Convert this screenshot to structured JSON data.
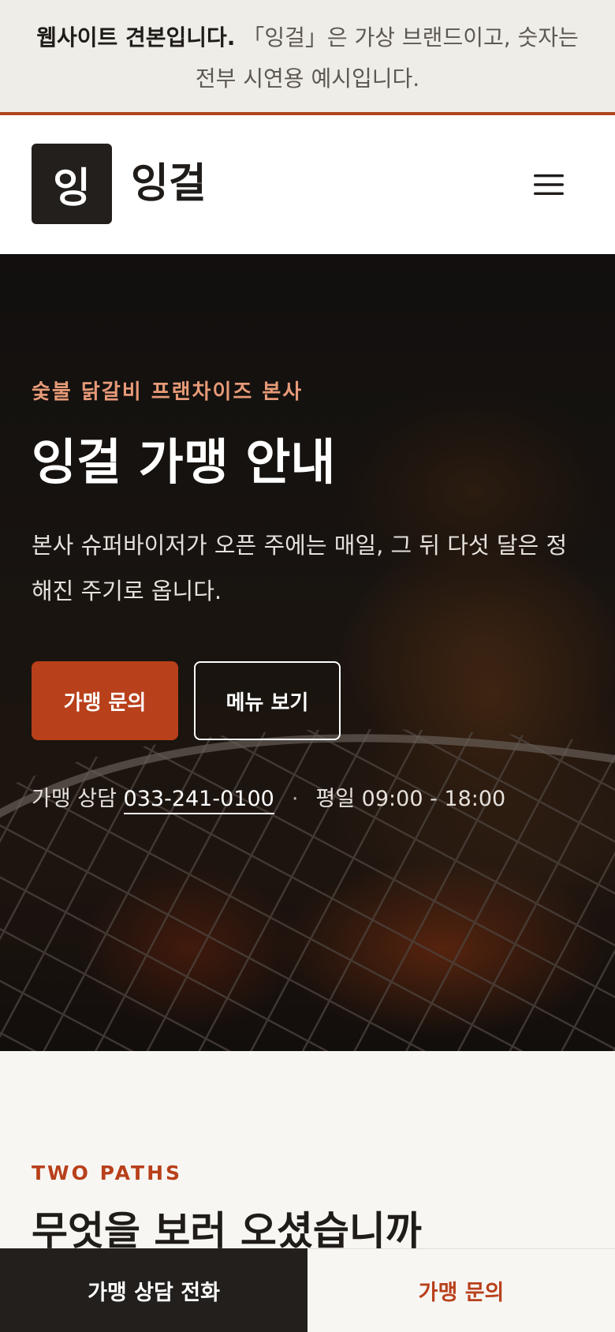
{
  "notice": {
    "bold": "웹사이트 견본입니다.",
    "text": " 「잉걸」은 가상 브랜드이고, 숫자는 전부 시연용 예시입니다."
  },
  "header": {
    "logo_mark": "잉",
    "brand_name": "잉걸",
    "menu_icon": "hamburger-menu-icon"
  },
  "hero": {
    "eyebrow": "숯불 닭갈비 프랜차이즈 본사",
    "title": "잉걸 가맹 안내",
    "description": "본사 슈퍼바이저가 오픈 주에는 매일, 그 뒤 다섯 달은 정해진 주기로 옵니다.",
    "primary_button": "가맹 문의",
    "secondary_button": "메뉴 보기",
    "contact_label": "가맹 상담",
    "phone": "033-241-0100",
    "separator": "·",
    "hours": "평일 09:00 - 18:00"
  },
  "section": {
    "eyebrow": "TWO PATHS",
    "title": "무엇을 보러 오셨습니까"
  },
  "bottom_bar": {
    "call_label": "가맹 상담 전화",
    "inquiry_label": "가맹 문의"
  },
  "colors": {
    "accent": "#b8401b",
    "dark": "#221f1c",
    "notice_bg": "#efede7",
    "page_bg": "#f8f6f3"
  }
}
